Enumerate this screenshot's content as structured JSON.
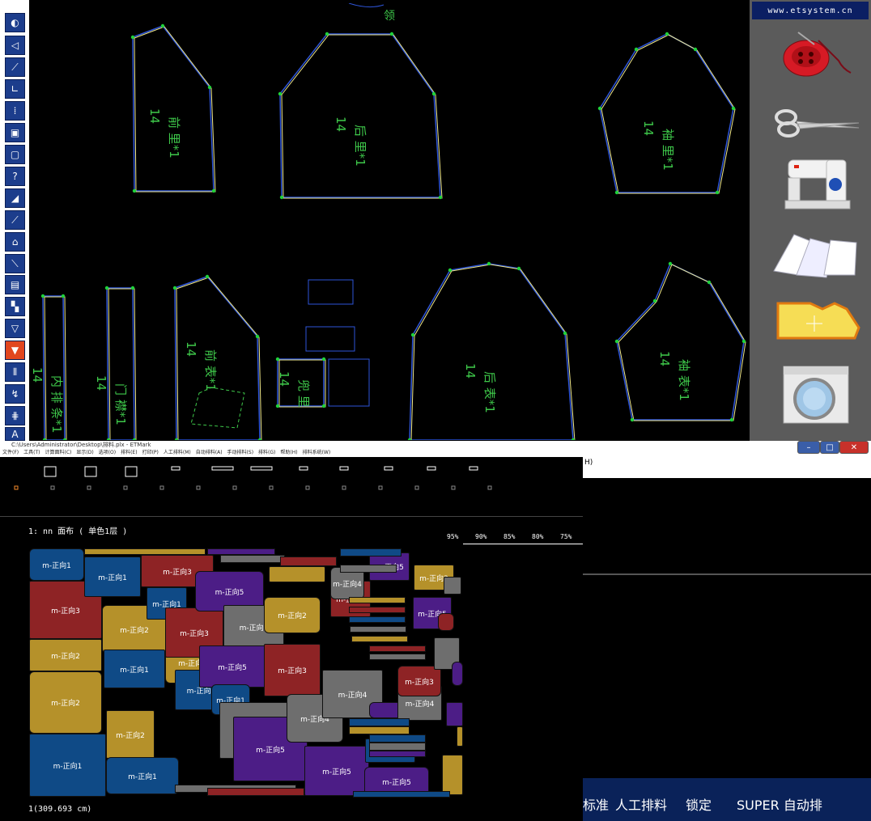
{
  "website": "www.etsystem.cn",
  "toolbar": {
    "tools": [
      "rotate-icon",
      "triangle-icon",
      "line-icon",
      "corner-icon",
      "split-icon",
      "frame-icon",
      "frame2-icon",
      "help-icon",
      "shape-icon",
      "graph-icon",
      "notch-icon",
      "slash-icon",
      "measure-icon",
      "grade-icon",
      "funnel-icon",
      "funnel2-icon",
      "align-icon",
      "chart-icon",
      "grid-icon",
      "text-icon"
    ],
    "text_tool_glyph": "A"
  },
  "cad_pieces": [
    {
      "id": "front-lining",
      "size": "14",
      "name": "前 里*1"
    },
    {
      "id": "back-lining",
      "size": "14",
      "name": "后 里*1"
    },
    {
      "id": "sleeve-lining",
      "size": "14",
      "name": "袖 里*1"
    },
    {
      "id": "inner-placket",
      "size": "14",
      "name": "内 排 条*1"
    },
    {
      "id": "door-placket",
      "size": "14",
      "name": "门 襟*1"
    },
    {
      "id": "front-outer",
      "size": "14",
      "name": "前 表*1"
    },
    {
      "id": "pocket-lining",
      "size": "14",
      "name": "兜 里"
    },
    {
      "id": "back-outer",
      "size": "14",
      "name": "后 表*1"
    },
    {
      "id": "sleeve-outer",
      "size": "14",
      "name": "袖 表*1"
    }
  ],
  "collar_label": "领",
  "right_panel_icons": [
    "button-thread-icon",
    "scissors-icon",
    "sewing-machine-icon",
    "paper-pattern-icon",
    "pattern-piece-icon",
    "washing-machine-icon"
  ],
  "bottom_window": {
    "title": "C:\\Users\\Administrator\\Desktop\\排料.plx - ETMark",
    "menu": [
      "文件(F)",
      "工具(T)",
      "计算面料(C)",
      "显示(D)",
      "选项(O)",
      "排料(E)",
      "打印(P)",
      "人工排料(M)",
      "自动排料(A)",
      "手动排料(S)",
      "排料(G)",
      "帮助(H)",
      "排料系统(W)"
    ],
    "info_label": "1: nn  面布  ( 单色1层 )",
    "percents": [
      "95%",
      "90%",
      "85%",
      "80%",
      "75%"
    ],
    "length_label": "1(309.693 cm)"
  },
  "marker_pieces": [
    {
      "label": "m-正向1",
      "color": "#0f4a86"
    },
    {
      "label": "m-正向2",
      "color": "#b5912a"
    },
    {
      "label": "m-正向3",
      "color": "#8e2325"
    },
    {
      "label": "m-正向4",
      "color": "#6e6e6e"
    },
    {
      "label": "m-正向5",
      "color": "#4c1d86"
    }
  ],
  "right_window": {
    "menu_fragment": "H)",
    "bottom_items": [
      "标准",
      "人工排料",
      "锁定",
      "SUPER 自动排"
    ],
    "controls": {
      "minimize": "minimize-button",
      "maximize": "maximize-button",
      "close": "close-button"
    }
  },
  "colors": {
    "cad_outline_blue": "#2e55d9",
    "cad_outline_yellow": "#f0e88a",
    "cad_point_green": "#1fd13a",
    "cad_text_green": "#3ec84a",
    "toolbar_blue": "#1c3d8c",
    "toolbar_selected": "#e2461e"
  }
}
